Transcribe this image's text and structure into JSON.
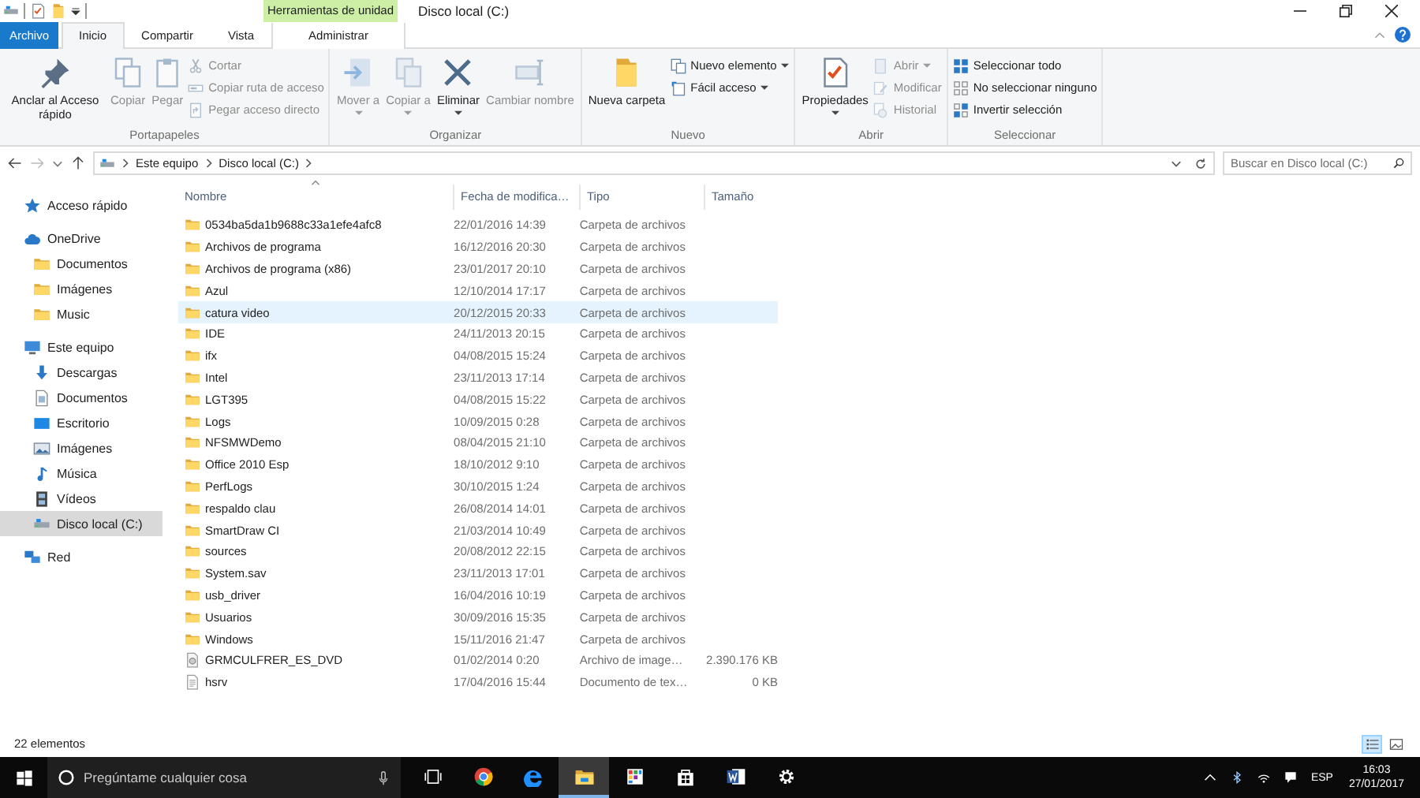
{
  "window": {
    "title": "Disco local (C:)",
    "contextual_group": "Herramientas de unidad"
  },
  "tabs": [
    {
      "label": "Archivo",
      "kind": "file",
      "selected": false
    },
    {
      "label": "Inicio",
      "kind": "normal",
      "selected": true
    },
    {
      "label": "Compartir",
      "kind": "normal",
      "selected": false
    },
    {
      "label": "Vista",
      "kind": "normal",
      "selected": false
    },
    {
      "label": "Administrar",
      "kind": "contextual",
      "selected": false
    }
  ],
  "ribbon": {
    "groups": [
      {
        "name": "Portapapeles",
        "large": [
          {
            "label": "Anclar al Acceso rápido",
            "kind": "pin",
            "disabled": false,
            "dropdown": false
          },
          {
            "label": "Copiar",
            "kind": "copy",
            "disabled": true,
            "dropdown": false
          },
          {
            "label": "Pegar",
            "kind": "paste",
            "disabled": true,
            "dropdown": false
          }
        ],
        "small": [
          {
            "label": "Cortar",
            "kind": "cut",
            "disabled": true,
            "dropdown": false
          },
          {
            "label": "Copiar ruta de acceso",
            "kind": "path",
            "disabled": true,
            "dropdown": false
          },
          {
            "label": "Pegar acceso directo",
            "kind": "shortcut",
            "disabled": true,
            "dropdown": false
          }
        ]
      },
      {
        "name": "Organizar",
        "large": [
          {
            "label": "Mover a",
            "kind": "move",
            "disabled": true,
            "dropdown": true
          },
          {
            "label": "Copiar a",
            "kind": "copyto",
            "disabled": true,
            "dropdown": true
          },
          {
            "label": "Eliminar",
            "kind": "delete",
            "disabled": false,
            "dropdown": true
          },
          {
            "label": "Cambiar nombre",
            "kind": "rename",
            "disabled": true,
            "dropdown": false
          }
        ]
      },
      {
        "name": "Nuevo",
        "large": [
          {
            "label": "Nueva carpeta",
            "kind": "newfolder",
            "disabled": false,
            "dropdown": false
          }
        ],
        "small": [
          {
            "label": "Nuevo elemento",
            "kind": "newitem",
            "disabled": false,
            "dropdown": true
          },
          {
            "label": "Fácil acceso",
            "kind": "easyaccess",
            "disabled": false,
            "dropdown": true
          }
        ]
      },
      {
        "name": "Abrir",
        "large": [
          {
            "label": "Propiedades",
            "kind": "properties",
            "disabled": false,
            "dropdown": true
          }
        ],
        "small": [
          {
            "label": "Abrir",
            "kind": "open",
            "disabled": true,
            "dropdown": true
          },
          {
            "label": "Modificar",
            "kind": "edit",
            "disabled": true,
            "dropdown": false
          },
          {
            "label": "Historial",
            "kind": "history",
            "disabled": true,
            "dropdown": false
          }
        ]
      },
      {
        "name": "Seleccionar",
        "small": [
          {
            "label": "Seleccionar todo",
            "kind": "selectall",
            "disabled": false,
            "dropdown": false
          },
          {
            "label": "No seleccionar ninguno",
            "kind": "selectnone",
            "disabled": false,
            "dropdown": false
          },
          {
            "label": "Invertir selección",
            "kind": "invert",
            "disabled": false,
            "dropdown": false
          }
        ]
      }
    ]
  },
  "address": {
    "path": [
      "Este equipo",
      "Disco local (C:)"
    ],
    "search_placeholder": "Buscar en Disco local (C:)"
  },
  "sidebar": {
    "items": [
      {
        "label": "Acceso rápido",
        "kind": "star",
        "selected": false
      },
      {
        "label": "OneDrive",
        "kind": "cloud",
        "selected": false,
        "children": [
          {
            "label": "Documentos",
            "kind": "folder",
            "selected": false
          },
          {
            "label": "Imágenes",
            "kind": "folder",
            "selected": false
          },
          {
            "label": "Music",
            "kind": "folder",
            "selected": false
          }
        ]
      },
      {
        "label": "Este equipo",
        "kind": "pc",
        "selected": false,
        "children": [
          {
            "label": "Descargas",
            "kind": "download",
            "selected": false
          },
          {
            "label": "Documentos",
            "kind": "document",
            "selected": false
          },
          {
            "label": "Escritorio",
            "kind": "desktop",
            "selected": false
          },
          {
            "label": "Imágenes",
            "kind": "pictures",
            "selected": false
          },
          {
            "label": "Música",
            "kind": "music",
            "selected": false
          },
          {
            "label": "Vídeos",
            "kind": "video",
            "selected": false
          },
          {
            "label": "Disco local (C:)",
            "kind": "drive",
            "selected": true
          }
        ]
      },
      {
        "label": "Red",
        "kind": "network",
        "selected": false
      }
    ]
  },
  "table": {
    "columns": [
      "Nombre",
      "Fecha de modifica…",
      "Tipo",
      "Tamaño"
    ],
    "rows": [
      {
        "name": "0534ba5da1b9688c33a1efe4afc8",
        "date": "22/01/2016 14:39",
        "type": "Carpeta de archivos",
        "kind": "folder",
        "selected": false
      },
      {
        "name": "Archivos de programa",
        "date": "16/12/2016 20:30",
        "type": "Carpeta de archivos",
        "kind": "folder",
        "selected": false
      },
      {
        "name": "Archivos de programa (x86)",
        "date": "23/01/2017 20:10",
        "type": "Carpeta de archivos",
        "kind": "folder",
        "selected": false
      },
      {
        "name": "Azul",
        "date": "12/10/2014 17:17",
        "type": "Carpeta de archivos",
        "kind": "folder",
        "selected": false
      },
      {
        "name": "catura video",
        "date": "20/12/2015 20:33",
        "type": "Carpeta de archivos",
        "kind": "folder",
        "selected": true
      },
      {
        "name": "IDE",
        "date": "24/11/2013 20:15",
        "type": "Carpeta de archivos",
        "kind": "folder",
        "selected": false
      },
      {
        "name": "ifx",
        "date": "04/08/2015 15:24",
        "type": "Carpeta de archivos",
        "kind": "folder",
        "selected": false
      },
      {
        "name": "Intel",
        "date": "23/11/2013 17:14",
        "type": "Carpeta de archivos",
        "kind": "folder",
        "selected": false
      },
      {
        "name": "LGT395",
        "date": "04/08/2015 15:22",
        "type": "Carpeta de archivos",
        "kind": "folder",
        "selected": false
      },
      {
        "name": "Logs",
        "date": "10/09/2015 0:28",
        "type": "Carpeta de archivos",
        "kind": "folder",
        "selected": false
      },
      {
        "name": "NFSMWDemo",
        "date": "08/04/2015 21:10",
        "type": "Carpeta de archivos",
        "kind": "folder",
        "selected": false
      },
      {
        "name": "Office 2010 Esp",
        "date": "18/10/2012 9:10",
        "type": "Carpeta de archivos",
        "kind": "folder",
        "selected": false
      },
      {
        "name": "PerfLogs",
        "date": "30/10/2015 1:24",
        "type": "Carpeta de archivos",
        "kind": "folder",
        "selected": false
      },
      {
        "name": "respaldo clau",
        "date": "26/08/2014 14:01",
        "type": "Carpeta de archivos",
        "kind": "folder",
        "selected": false
      },
      {
        "name": "SmartDraw CI",
        "date": "21/03/2014 10:49",
        "type": "Carpeta de archivos",
        "kind": "folder",
        "selected": false
      },
      {
        "name": "sources",
        "date": "20/08/2012 22:15",
        "type": "Carpeta de archivos",
        "kind": "folder",
        "selected": false
      },
      {
        "name": "System.sav",
        "date": "23/11/2013 17:01",
        "type": "Carpeta de archivos",
        "kind": "folder",
        "selected": false
      },
      {
        "name": "usb_driver",
        "date": "16/04/2016 10:19",
        "type": "Carpeta de archivos",
        "kind": "folder",
        "selected": false
      },
      {
        "name": "Usuarios",
        "date": "30/09/2016 15:35",
        "type": "Carpeta de archivos",
        "kind": "folder",
        "selected": false
      },
      {
        "name": "Windows",
        "date": "15/11/2016 21:47",
        "type": "Carpeta de archivos",
        "kind": "folder",
        "selected": false
      },
      {
        "name": "GRMCULFRER_ES_DVD",
        "date": "01/02/2014 0:20",
        "type": "Archivo de image…",
        "size": "2.390.176 KB",
        "kind": "disc_image",
        "selected": false
      },
      {
        "name": "hsrv",
        "date": "17/04/2016 15:44",
        "type": "Documento de tex…",
        "size": "0 KB",
        "kind": "text",
        "selected": false
      }
    ]
  },
  "status_bar": {
    "text": "22 elementos",
    "views": [
      {
        "kind": "details",
        "selected": true
      },
      {
        "kind": "large_icons",
        "selected": false
      }
    ]
  },
  "taskbar": {
    "search_placeholder": "Pregúntame cualquier cosa",
    "apps": [
      {
        "kind": "task_view",
        "active": false
      },
      {
        "kind": "chrome",
        "active": false
      },
      {
        "kind": "edge",
        "active": false
      },
      {
        "kind": "explorer",
        "active": true
      },
      {
        "kind": "calculator",
        "active": false
      },
      {
        "kind": "store",
        "active": false
      },
      {
        "kind": "word",
        "active": false
      },
      {
        "kind": "settings",
        "active": false
      }
    ],
    "language": "ESP",
    "time": "16:03",
    "date": "27/01/2017"
  }
}
